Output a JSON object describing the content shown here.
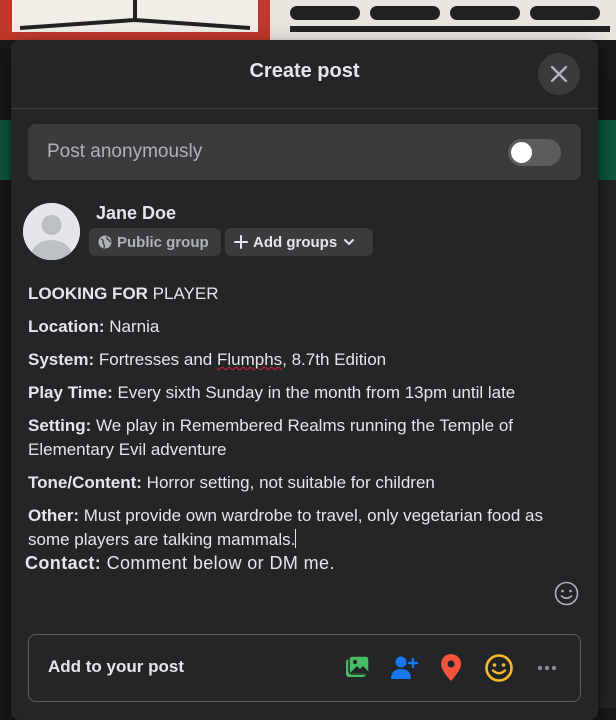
{
  "modal": {
    "title": "Create post"
  },
  "anonymous": {
    "label": "Post anonymously",
    "enabled": false
  },
  "author": {
    "name": "Jane Doe",
    "audience_label": "Public group",
    "add_groups_label": "Add groups"
  },
  "post": {
    "looking_for_bold": "LOOKING FOR",
    "looking_for_rest": " PLAYER",
    "location_key": "Location:",
    "location_value": " Narnia",
    "system_key": "System:",
    "system_value_a": " Fortresses and ",
    "system_value_misspelled": "Flumphs",
    "system_value_b": ", 8.7th Edition",
    "playtime_key": "Play Time:",
    "playtime_value": " Every sixth Sunday in the month from 13pm until late",
    "setting_key": "Setting:",
    "setting_value": " We play in Remembered Realms running the Temple of Elementary Evil adventure",
    "tone_key": "Tone/Content:",
    "tone_value": " Horror setting, not suitable for children",
    "other_key": "Other:",
    "other_value": " Must provide own wardrobe to travel, only vegetarian food as some players are talking mammals.",
    "contact_key": "Contact:",
    "contact_value": " Comment below or DM me."
  },
  "add_to_post": {
    "label": "Add to your post",
    "icons": [
      "photo-video-icon",
      "tag-people-icon",
      "check-in-icon",
      "feeling-activity-icon",
      "more-icon"
    ]
  },
  "colors": {
    "modal_bg": "#242526",
    "input_bg": "#3a3b3c",
    "photo_green": "#45bd62",
    "tag_blue": "#1877f2",
    "location_red": "#f5533d",
    "feeling_yellow": "#f7b928"
  }
}
